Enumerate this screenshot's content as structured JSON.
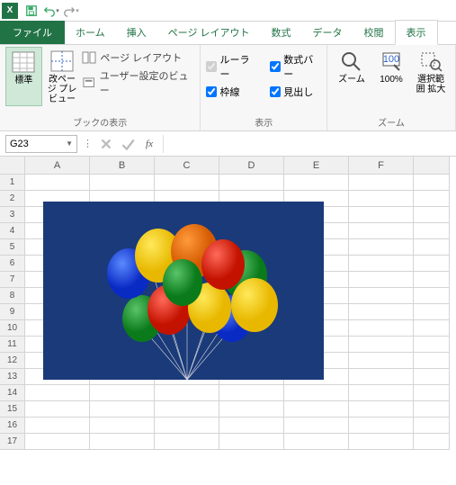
{
  "qat": {
    "app": "X"
  },
  "tabs": {
    "file": "ファイル",
    "home": "ホーム",
    "insert": "挿入",
    "pagelayout": "ページ レイアウト",
    "formulas": "数式",
    "data": "データ",
    "review": "校閲",
    "view": "表示"
  },
  "ribbon": {
    "views": {
      "normal": "標準",
      "pagebreak": "改ページ\nプレビュー",
      "pagelayout": "ページ レイアウト",
      "custom": "ユーザー設定のビュー",
      "group": "ブックの表示"
    },
    "show": {
      "ruler": "ルーラー",
      "formulabar": "数式バー",
      "gridlines": "枠線",
      "headings": "見出し",
      "group": "表示"
    },
    "zoom": {
      "zoom": "ズーム",
      "hundred": "100%",
      "selection": "選択範囲\n拡大",
      "group": "ズーム"
    }
  },
  "formula": {
    "cellref": "G23",
    "fx": "fx"
  },
  "cols": [
    "A",
    "B",
    "C",
    "D",
    "E",
    "F"
  ],
  "rows": [
    "1",
    "2",
    "3",
    "4",
    "5",
    "6",
    "7",
    "8",
    "9",
    "10",
    "11",
    "12",
    "13",
    "14",
    "15",
    "16",
    "17"
  ]
}
